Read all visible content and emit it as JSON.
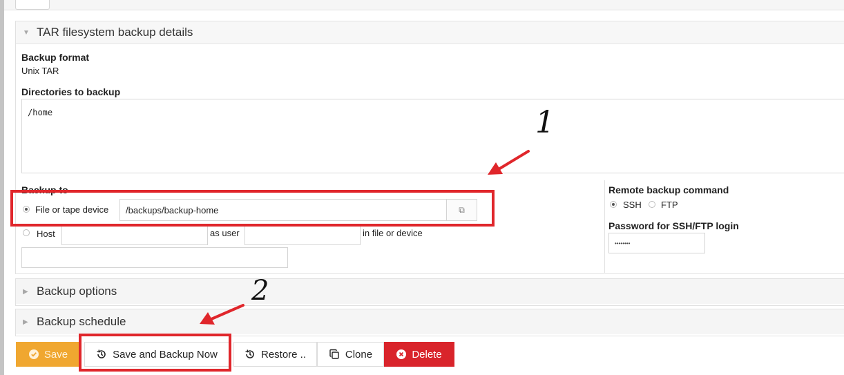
{
  "details_section": {
    "title": "TAR filesystem backup details",
    "backup_format_label": "Backup format",
    "backup_format_value": "Unix TAR",
    "directories_label": "Directories to backup",
    "directories_value": "/home",
    "backup_to_label": "Backup to",
    "file_device_option": "File or tape device",
    "file_device_value": "/backups/backup-home",
    "host_option": "Host",
    "as_user_label": "as user",
    "in_file_label": "in file or device",
    "remote_command_label": "Remote backup command",
    "ssh_option": "SSH",
    "ftp_option": "FTP",
    "password_label": "Password for SSH/FTP login",
    "password_value": "••••••••"
  },
  "collapsed_sections": {
    "options_title": "Backup options",
    "schedule_title": "Backup schedule"
  },
  "buttons": {
    "save": "Save",
    "save_backup_now": "Save and Backup Now",
    "restore": "Restore ..",
    "clone": "Clone",
    "delete": "Delete"
  },
  "annotations": {
    "step_one": "1",
    "step_two": "2",
    "highlight_color": "#e0262b"
  },
  "colors": {
    "save_button": "#f0a730",
    "delete_button": "#d9242b"
  }
}
